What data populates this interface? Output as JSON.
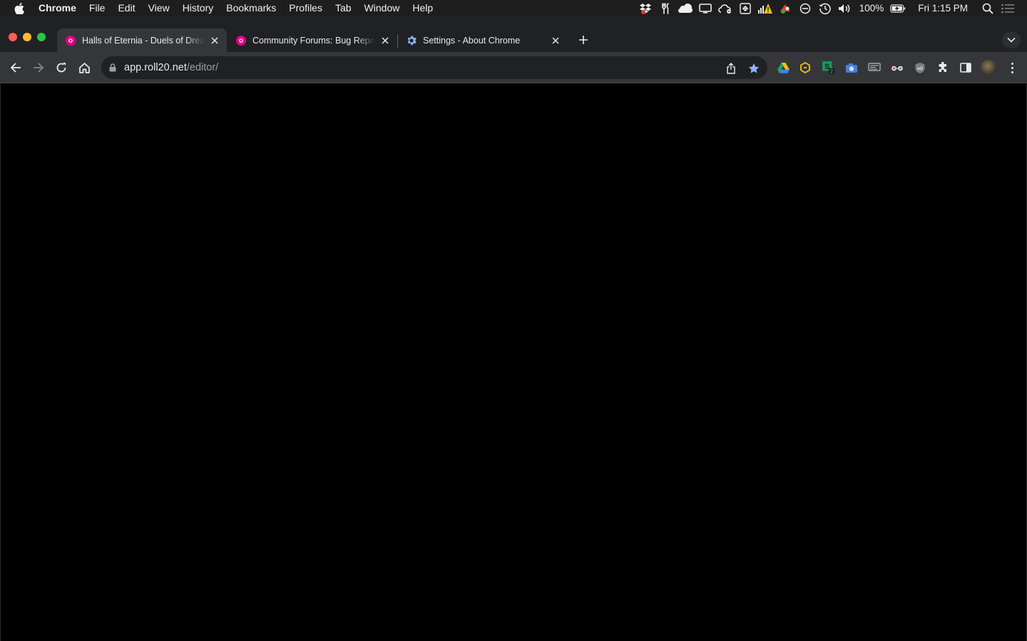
{
  "menubar": {
    "apple_icon": "apple-logo-icon",
    "app_name": "Chrome",
    "menus": [
      "File",
      "Edit",
      "View",
      "History",
      "Bookmarks",
      "Profiles",
      "Tab",
      "Window",
      "Help"
    ],
    "battery_percent": "100%",
    "clock": "Fri 1:15 PM"
  },
  "tabs": [
    {
      "title": "Halls of Eternia - Duels of Dreams",
      "favicon": "roll20-icon",
      "active": true
    },
    {
      "title": "Community Forums: Bug Reports",
      "favicon": "roll20-icon",
      "active": false
    },
    {
      "title": "Settings - About Chrome",
      "favicon": "settings-gear-icon",
      "active": false
    }
  ],
  "toolbar": {
    "url_host": "app.roll20.net",
    "url_path": "/editor/"
  },
  "colors": {
    "roll20_pink": "#e10085",
    "chrome_blue": "#8ab4f8",
    "page_background": "#000000"
  }
}
